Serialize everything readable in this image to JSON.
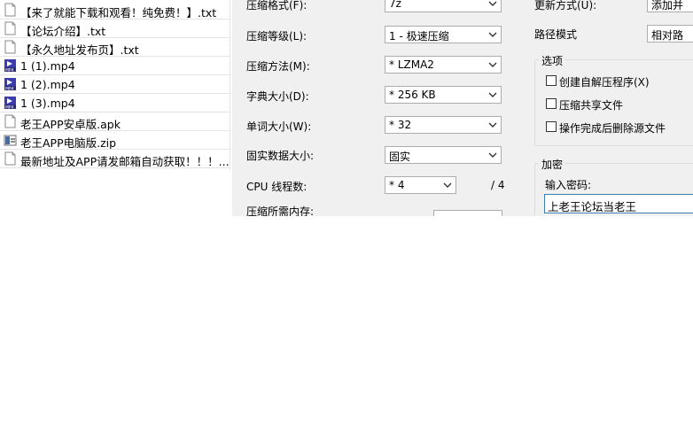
{
  "files": [
    {
      "name": "【来了就能下载和观看！纯免费！】.txt",
      "icon": "text-file-icon"
    },
    {
      "name": "【论坛介绍】.txt",
      "icon": "text-file-icon"
    },
    {
      "name": "【永久地址发布页】.txt",
      "icon": "text-file-icon"
    },
    {
      "name": "1 (1).mp4",
      "icon": "mp4-video-icon"
    },
    {
      "name": "1 (2).mp4",
      "icon": "mp4-video-icon"
    },
    {
      "name": "1 (3).mp4",
      "icon": "mp4-video-icon"
    },
    {
      "name": "老王APP安卓版.apk",
      "icon": "file-icon"
    },
    {
      "name": "老王APP电脑版.zip",
      "icon": "zip-archive-icon"
    },
    {
      "name": "最新地址及APP请发邮箱自动获取！！！....",
      "icon": "text-file-icon"
    }
  ],
  "dialog": {
    "format_label": "压缩格式(F):",
    "format_value": "7z",
    "level_label": "压缩等级(L):",
    "level_value": "1 - 极速压缩",
    "method_label": "压缩方法(M):",
    "method_value": "* LZMA2",
    "dict_label": "字典大小(D):",
    "dict_value": "* 256 KB",
    "word_label": "单词大小(W):",
    "word_value": "* 32",
    "solid_label": "固实数据大小:",
    "solid_value": "固实",
    "cpu_label": "CPU 线程数:",
    "cpu_value": "* 4",
    "cpu_total": "/ 4",
    "memory_label": "压缩所需内存:",
    "update_label": "更新方式(U):",
    "update_value": "添加并",
    "path_label": "路径模式",
    "path_value": "相对路",
    "options_title": "选项",
    "opt_sfx": "创建自解压程序(X)",
    "opt_shared": "压缩共享文件",
    "opt_delete": "操作完成后删除源文件",
    "encrypt_title": "加密",
    "password_label": "输入密码:",
    "password_value": "上老王论坛当老王"
  }
}
